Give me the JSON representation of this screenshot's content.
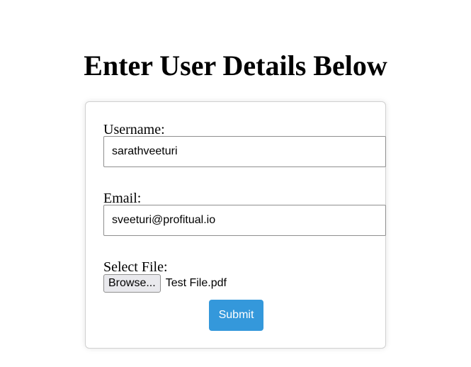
{
  "page": {
    "title": "Enter User Details Below"
  },
  "form": {
    "username": {
      "label": "Username:",
      "value": "sarathveeturi"
    },
    "email": {
      "label": "Email:",
      "value": "sveeturi@profitual.io"
    },
    "file": {
      "label": "Select File:",
      "browse_label": "Browse...",
      "selected_file": "Test File.pdf"
    },
    "submit_label": "Submit"
  },
  "colors": {
    "submit_background": "#3498db",
    "submit_text": "#ffffff",
    "card_border": "#d0d0d0"
  }
}
